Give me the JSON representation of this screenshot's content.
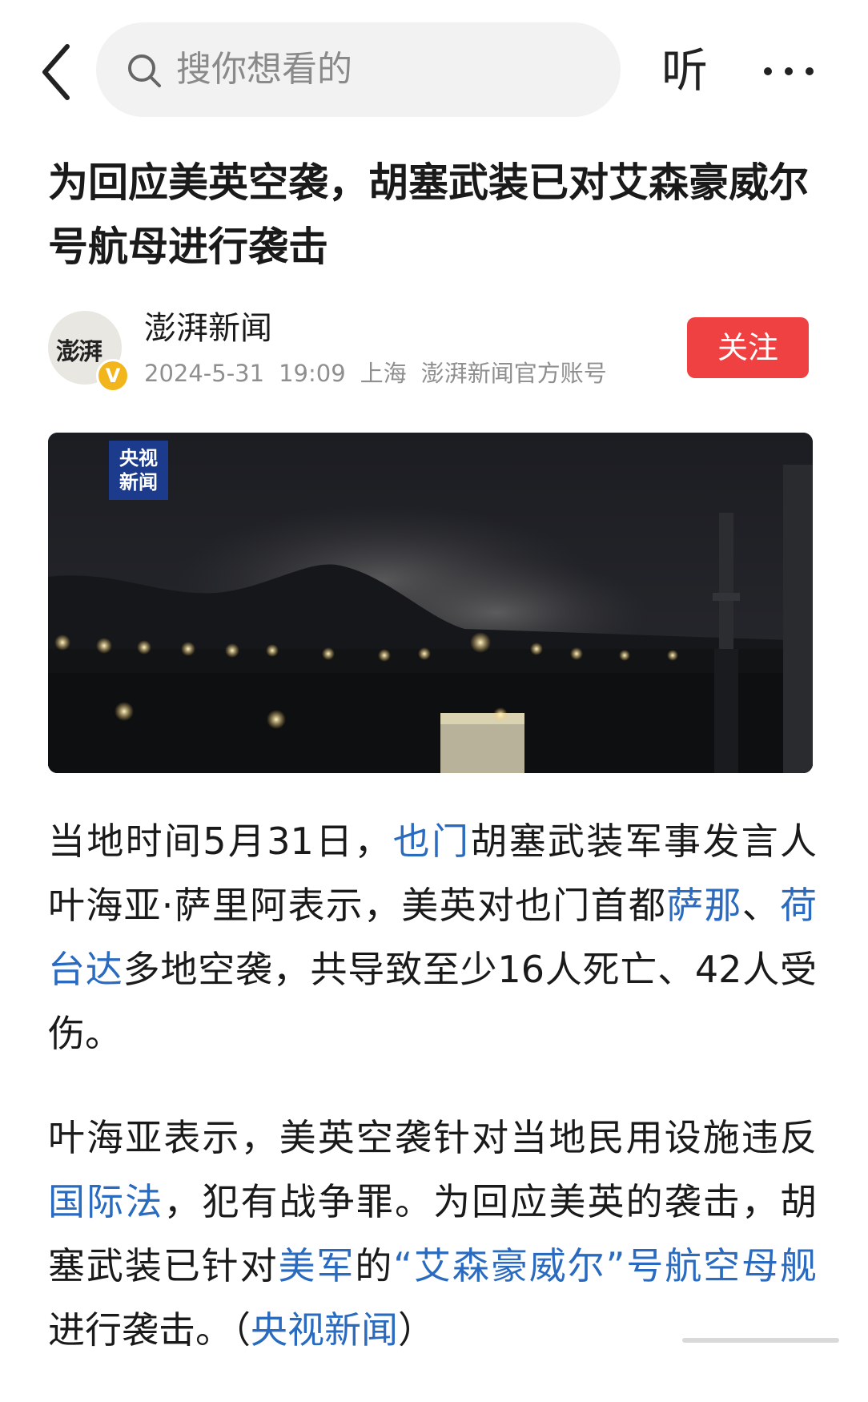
{
  "header": {
    "back_icon": "chevron-left-icon",
    "search_placeholder": "搜你想看的",
    "search_icon": "search-icon",
    "listen_label": "听",
    "more_icon": "more-horizontal-icon"
  },
  "article": {
    "title": "为回应美英空袭，胡塞武装已对艾森豪威尔号航母进行袭击",
    "source": {
      "name": "澎湃新闻",
      "avatar_text": "澎湃",
      "verified_badge": "V",
      "date": "2024-5-31",
      "time": "19:09",
      "location": "上海",
      "account_type": "澎湃新闻官方账号",
      "follow_label": "关注"
    },
    "image": {
      "watermark_line1": "央视",
      "watermark_line2": "新闻"
    },
    "paragraphs": [
      [
        {
          "text": "当地时间5月31日，"
        },
        {
          "text": "也门",
          "link": true
        },
        {
          "text": "胡塞武装军事发言人叶海亚·萨里阿表示，美英对也门首都"
        },
        {
          "text": "萨那",
          "link": true
        },
        {
          "text": "、"
        },
        {
          "text": "荷台达",
          "link": true
        },
        {
          "text": "多地空袭，共导致至少16人死亡、42人受伤。"
        }
      ],
      [
        {
          "text": "叶海亚表示，美英空袭针对当地民用设施违反"
        },
        {
          "text": "国际法",
          "link": true
        },
        {
          "text": "，犯有战争罪。为回应美英的袭击，胡塞武装已针对"
        },
        {
          "text": "美军",
          "link": true
        },
        {
          "text": "的"
        },
        {
          "text": "“艾森豪威尔”号航空母舰",
          "link": true
        },
        {
          "text": "进行袭击。（"
        },
        {
          "text": "央视新闻",
          "link": true
        },
        {
          "text": "）"
        }
      ]
    ]
  },
  "colors": {
    "accent_red": "#f04142",
    "link_blue": "#2a6bbf",
    "badge_gold": "#f2b51c",
    "cctv_blue": "#1d3b8c"
  }
}
